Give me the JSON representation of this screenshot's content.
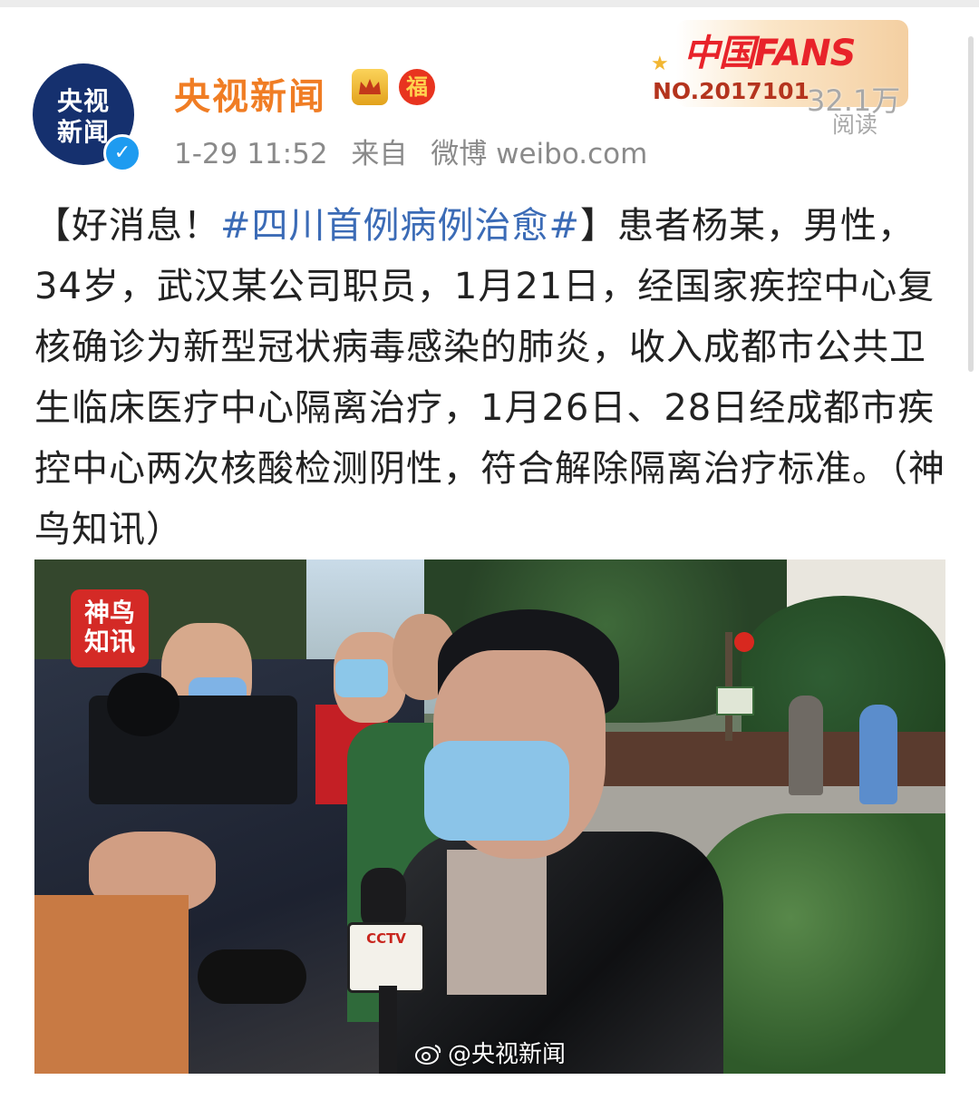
{
  "post": {
    "author": {
      "name": "央视新闻",
      "avatar_line1": "央视",
      "avatar_line2": "新闻",
      "badge_fu": "福",
      "verified_mark": "✓"
    },
    "meta": {
      "time": "1-29 11:52",
      "source_prefix": "来自",
      "source": "微博 weibo.com"
    },
    "fans_banner": {
      "title": "中国FANS",
      "number": "NO.2017101",
      "read_count": "32.1万",
      "read_label": "阅读"
    },
    "text": {
      "open_bracket": "【好消息！",
      "hashtag": "#四川首例病例治愈#",
      "body": "】患者杨某，男性，34岁，武汉某公司职员，1月21日，经国家疾控中心复核确诊为新型冠状病毒感染的肺炎，收入成都市公共卫生临床医疗中心隔离治疗，1月26日、28日经成都市疾控中心两次核酸检测阴性，符合解除隔离治疗标准。（神鸟知讯）"
    },
    "image": {
      "logo_text": "神鸟知讯",
      "mic_flag_text": "CCTV",
      "watermark": "@央视新闻"
    }
  },
  "colors": {
    "author_name": "#f07d24",
    "hashtag": "#3b6bb6",
    "meta_text": "#8a8a8a",
    "verified": "#1e9bf0"
  },
  "icons": [
    "verified-icon",
    "crown-badge-icon",
    "fu-badge-icon",
    "weibo-logo-icon"
  ]
}
